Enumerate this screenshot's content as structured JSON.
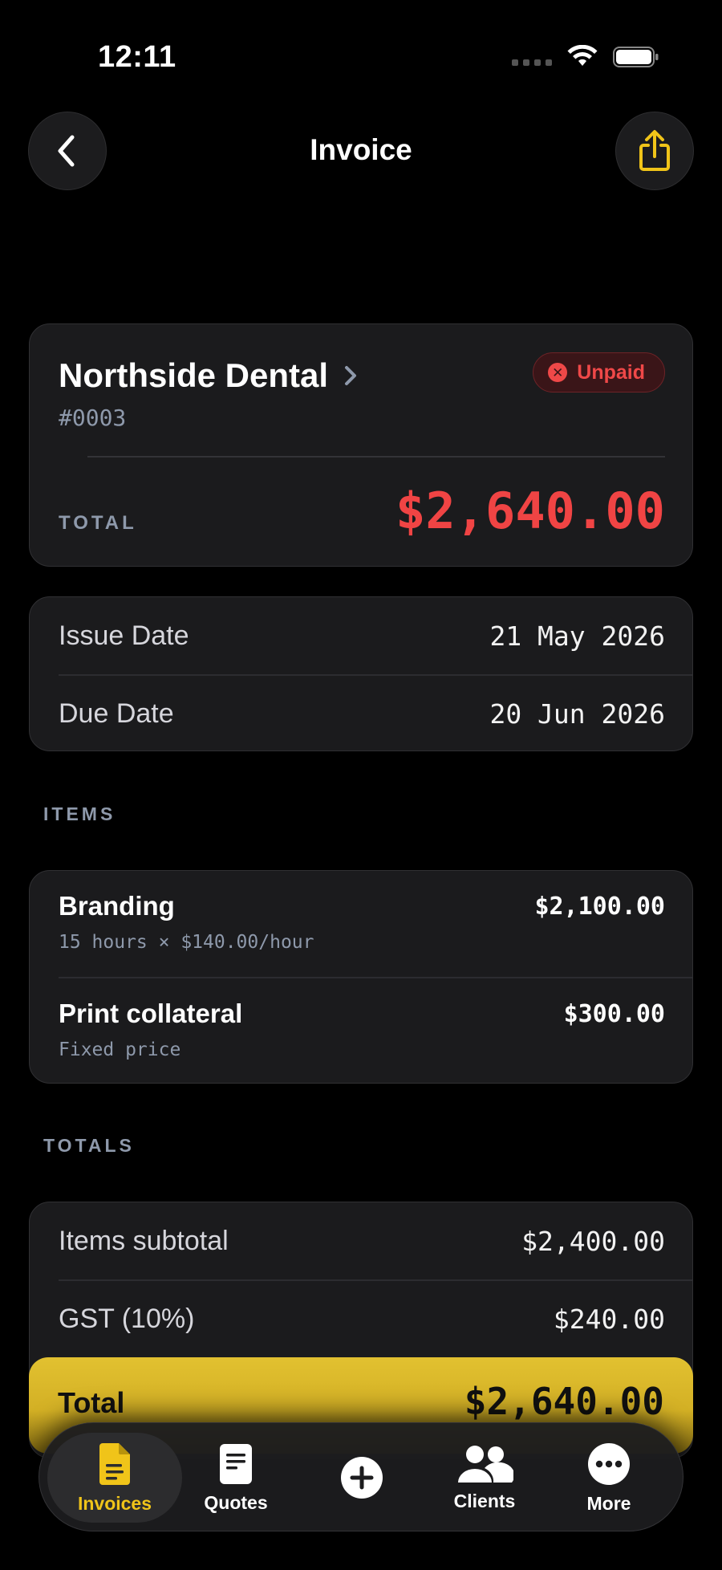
{
  "status": {
    "time": "12:11"
  },
  "nav": {
    "title": "Invoice"
  },
  "invoice": {
    "client": "Northside Dental",
    "number": "#0003",
    "status_badge": "Unpaid",
    "total_label": "TOTAL",
    "total_amount": "$2,640.00"
  },
  "dates": [
    {
      "label": "Issue Date",
      "value": "21 May 2026"
    },
    {
      "label": "Due Date",
      "value": "20 Jun 2026"
    }
  ],
  "items_section": {
    "label": "ITEMS"
  },
  "items": [
    {
      "name": "Branding",
      "detail": "15 hours × $140.00/hour",
      "amount": "$2,100.00"
    },
    {
      "name": "Print collateral",
      "detail": "Fixed price",
      "amount": "$300.00"
    }
  ],
  "totals_section": {
    "label": "TOTALS"
  },
  "totals": [
    {
      "label": "Items subtotal",
      "value": "$2,400.00"
    },
    {
      "label": "GST (10%)",
      "value": "$240.00"
    }
  ],
  "grand_total": {
    "label": "Total",
    "value": "$2,640.00"
  },
  "tabbar": {
    "tabs": [
      {
        "label": "Invoices",
        "icon": "invoice-document-icon",
        "active": true
      },
      {
        "label": "Quotes",
        "icon": "quote-document-icon"
      },
      {
        "label": "",
        "icon": "add-circle-icon"
      },
      {
        "label": "Clients",
        "icon": "people-icon"
      },
      {
        "label": "More",
        "icon": "ellipsis-circle-icon"
      }
    ]
  },
  "colors": {
    "accent": "#f0c419",
    "danger": "#ef4848",
    "background": "#000000",
    "card": "#1b1b1d"
  }
}
